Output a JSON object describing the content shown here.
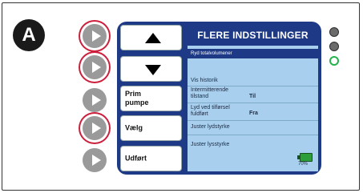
{
  "badge": "A",
  "side_buttons": [
    {
      "name": "side-button-1",
      "highlighted": true
    },
    {
      "name": "side-button-2",
      "highlighted": true
    },
    {
      "name": "side-button-3",
      "highlighted": false
    },
    {
      "name": "side-button-4",
      "highlighted": true
    },
    {
      "name": "side-button-5",
      "highlighted": false
    }
  ],
  "softkeys": {
    "up": "arrow-up-icon",
    "down": "arrow-down-icon",
    "prime": "Prim\npumpe",
    "select": "Vælg",
    "done": "Udført"
  },
  "screen": {
    "title": "FLERE INDSTILLINGER",
    "selected_item": "Ryd totalvolumener",
    "items": [
      {
        "label": "Vis historik",
        "value": ""
      },
      {
        "label": "Intermitterende\ntilstand",
        "value": "Til"
      },
      {
        "label": "Lyd ved tilførsel\nfuldført",
        "value": "Fra"
      },
      {
        "label": "Juster lydstyrke",
        "value": ""
      },
      {
        "label": "Juster lysstyrke",
        "value": ""
      }
    ],
    "battery_percent": "70%"
  },
  "leds": [
    {
      "name": "led-gray-1",
      "color": "#6b6b6b"
    },
    {
      "name": "led-gray-2",
      "color": "#6b6b6b"
    },
    {
      "name": "led-green",
      "color": "#22b34a"
    }
  ],
  "colors": {
    "highlight_ring": "#cc1f3c",
    "device_blue": "#1e3a86",
    "screen_bg": "#a8d0ee"
  }
}
